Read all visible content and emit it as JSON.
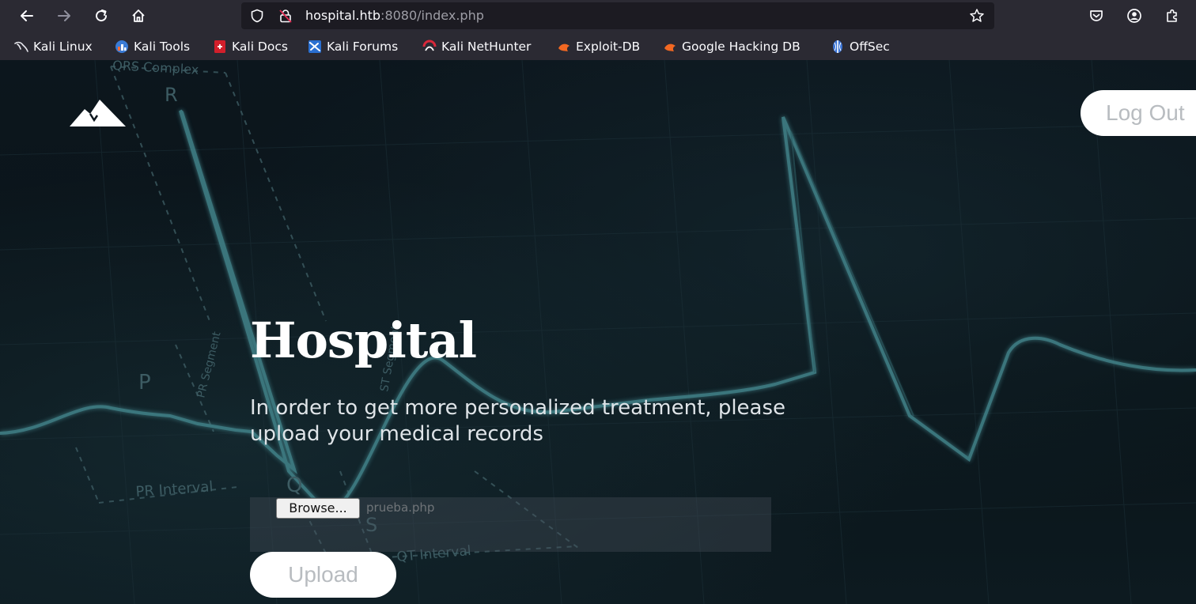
{
  "browser": {
    "url_host": "hospital.htb",
    "url_rest": ":8080/index.php",
    "bookmarks": [
      {
        "label": "Kali Linux",
        "icon": "kali-dragon-icon"
      },
      {
        "label": "Kali Tools",
        "icon": "kali-tools-icon"
      },
      {
        "label": "Kali Docs",
        "icon": "kali-docs-icon"
      },
      {
        "label": "Kali Forums",
        "icon": "kali-forums-icon"
      },
      {
        "label": "Kali NetHunter",
        "icon": "kali-nethunter-icon"
      },
      {
        "label": "Exploit-DB",
        "icon": "exploit-db-icon"
      },
      {
        "label": "Google Hacking DB",
        "icon": "exploit-db-icon"
      },
      {
        "label": "OffSec",
        "icon": "offsec-icon"
      }
    ]
  },
  "page": {
    "logout_label": "Log Out",
    "title": "Hospital",
    "description": "In order to get more personalized treatment, please upload your medical records",
    "browse_label": "Browse...",
    "selected_file": "prueba.php",
    "upload_label": "Upload"
  },
  "background_labels": {
    "qrs": "QRS Complex",
    "r": "R",
    "p": "P",
    "pr_segment": "PR Segment",
    "st_segment": "ST Segment",
    "pr_interval": "PR Interval",
    "q": "Q",
    "s": "S",
    "qt_interval": "QT Interval"
  },
  "colors": {
    "chrome_bg": "#2b2a33",
    "urlbar_bg": "#1c1b22",
    "page_bg": "#0b1218",
    "ecg_line": "#3f7f86",
    "button_bg": "#ffffff",
    "button_text": "#b8bcc0"
  }
}
